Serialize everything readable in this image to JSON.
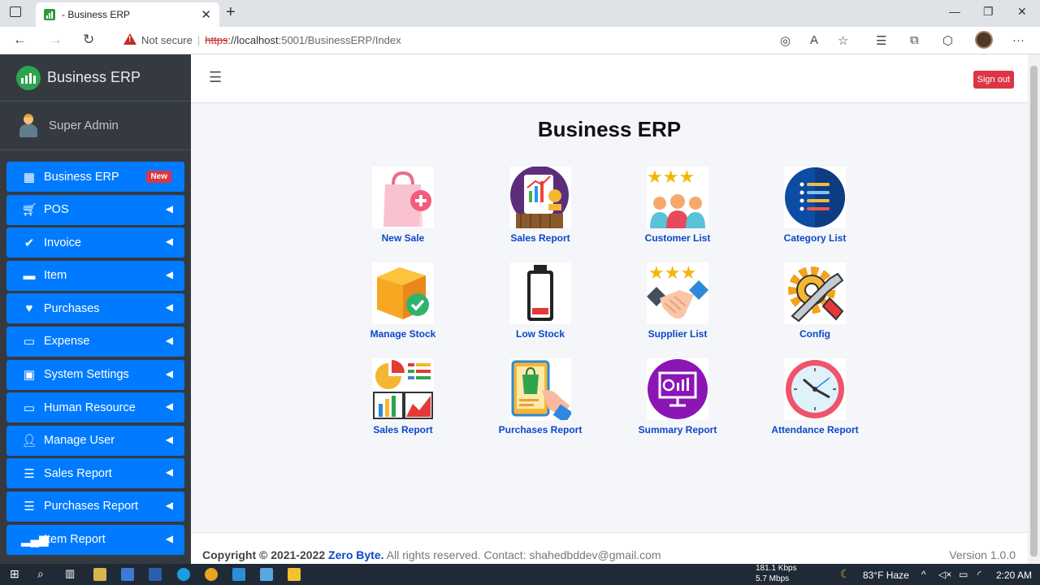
{
  "browser": {
    "tab_title": "- Business ERP",
    "url_warning": "Not secure",
    "url_scheme": "https",
    "url_host": "://localhost",
    "url_path": ":5001/BusinessERP/Index"
  },
  "sidebar": {
    "brand": "Business ERP",
    "user": "Super Admin",
    "items": [
      {
        "label": "Business ERP",
        "badge": "New",
        "icon": "grid-icon"
      },
      {
        "label": "POS",
        "icon": "cart-icon"
      },
      {
        "label": "Invoice",
        "icon": "check-circle-icon"
      },
      {
        "label": "Item",
        "icon": "item-icon"
      },
      {
        "label": "Purchases",
        "icon": "heart-icon"
      },
      {
        "label": "Expense",
        "icon": "monitor-icon"
      },
      {
        "label": "System Settings",
        "icon": "toolbox-icon"
      },
      {
        "label": "Human Resource",
        "icon": "monitor-icon"
      },
      {
        "label": "Manage User",
        "icon": "user-cog-icon"
      },
      {
        "label": "Sales Report",
        "icon": "database-icon"
      },
      {
        "label": "Purchases Report",
        "icon": "database-icon"
      },
      {
        "label": "Item Report",
        "icon": "signal-icon"
      }
    ]
  },
  "header": {
    "signout": "Sign out"
  },
  "main": {
    "title": "Business ERP",
    "tiles": [
      {
        "label": "New Sale",
        "icon": "shopping-bag-icon"
      },
      {
        "label": "Sales Report",
        "icon": "sales-report-icon"
      },
      {
        "label": "Customer List",
        "icon": "customers-icon"
      },
      {
        "label": "Category List",
        "icon": "list-icon"
      },
      {
        "label": "Manage Stock",
        "icon": "box-icon"
      },
      {
        "label": "Low Stock",
        "icon": "battery-low-icon"
      },
      {
        "label": "Supplier List",
        "icon": "handshake-icon"
      },
      {
        "label": "Config",
        "icon": "gear-tools-icon"
      },
      {
        "label": "Sales Report",
        "icon": "charts-icon"
      },
      {
        "label": "Purchases Report",
        "icon": "tablet-bag-icon"
      },
      {
        "label": "Summary Report",
        "icon": "presentation-icon"
      },
      {
        "label": "Attendance Report",
        "icon": "clock-icon"
      }
    ]
  },
  "footer": {
    "copyright_prefix": "Copyright © 2021-2022",
    "company": "Zero Byte.",
    "rest": " All rights reserved. Contact: shahedbddev@gmail.com",
    "version": "Version 1.0.0"
  },
  "taskbar": {
    "net_up": "181.1 Kbps",
    "net_down": "5.7 Mbps",
    "weather": "83°F  Haze",
    "time": "2:20 AM"
  },
  "colors": {
    "accent": "#007bff",
    "sidebar_bg": "#343a40",
    "signout": "#dc3545",
    "tile_label": "#0d47c9"
  }
}
